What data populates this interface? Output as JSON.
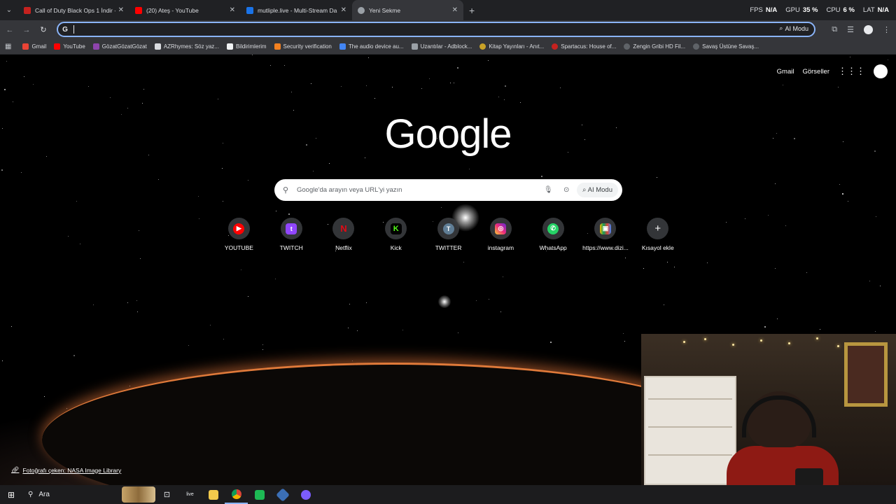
{
  "browser": {
    "tabs": [
      {
        "title": "Call of Duty Black Ops 1 İndir - ",
        "favicon_color": "#c5221f",
        "active": false
      },
      {
        "title": "(20) Ateş - YouTube",
        "favicon_color": "#ff0000",
        "active": false
      },
      {
        "title": "mutliple.live - Multi-Stream Da",
        "favicon_color": "#1a73e8",
        "active": false
      },
      {
        "title": "Yeni Sekme",
        "favicon_color": "#9aa0a6",
        "active": true
      }
    ],
    "new_tab_icon": "plus-icon",
    "overlay_stats": {
      "fps_label": "FPS",
      "fps_value": "N/A",
      "gpu_label": "GPU",
      "gpu_value": "35 %",
      "cpu_label": "CPU",
      "cpu_value": "6 %",
      "lat_label": "LAT",
      "lat_value": "N/A"
    },
    "omnibox": {
      "value": "",
      "ai_mode_label": "AI Modu"
    },
    "bookmarks": [
      {
        "label": "Gmail",
        "color": "#ea4335"
      },
      {
        "label": "YouTube",
        "color": "#ff0000"
      },
      {
        "label": "GözatGözatGözat",
        "color": "#8e44ad"
      },
      {
        "label": "AZRhymes: Söz yaz...",
        "color": "#dadce0"
      },
      {
        "label": "Bildirimlerim",
        "color": "#f1f3f4"
      },
      {
        "label": "Security verification",
        "color": "#f48120"
      },
      {
        "label": "The audio device au...",
        "color": "#4285f4"
      },
      {
        "label": "Uzantılar - Adblock...",
        "color": "#9aa0a6"
      },
      {
        "label": "Kitap Yayınları - Anıt...",
        "color": "#c9a227"
      },
      {
        "label": "Spartacus: House of...",
        "color": "#c5221f"
      },
      {
        "label": "Zengin Gribi HD Fil...",
        "color": "#5f6368"
      },
      {
        "label": "Savaş Üstüne Savaş...",
        "color": "#5f6368"
      }
    ]
  },
  "newtab": {
    "links": {
      "gmail": "Gmail",
      "images": "Görseller"
    },
    "logo": "Google",
    "search": {
      "placeholder": "Google'da arayın veya URL'yi yazın",
      "ai_mode_label": "AI Modu"
    },
    "shortcuts": [
      {
        "label": "YOUTUBE",
        "icon": "youtube-icon",
        "color": "#ff0000",
        "glyph": "▶"
      },
      {
        "label": "TWITCH",
        "icon": "twitch-icon",
        "color": "#9146ff",
        "glyph": "t"
      },
      {
        "label": "Netflix",
        "icon": "netflix-icon",
        "color": "#e50914",
        "glyph": "N"
      },
      {
        "label": "Kick",
        "icon": "kick-icon",
        "color": "#53fc18",
        "glyph": "K"
      },
      {
        "label": "TWITTER",
        "icon": "twitter-icon",
        "color": "#5f7d95",
        "glyph": "T"
      },
      {
        "label": "instagram",
        "icon": "instagram-icon",
        "color": "#e1306c",
        "glyph": "◎"
      },
      {
        "label": "WhatsApp",
        "icon": "whatsapp-icon",
        "color": "#25d366",
        "glyph": "✆"
      },
      {
        "label": "https://www.dizi...",
        "icon": "tv-icon",
        "color": "#3c4043",
        "glyph": "▣"
      },
      {
        "label": "Kısayol ekle",
        "icon": "plus-icon",
        "color": "#3c4043",
        "glyph": "+"
      }
    ],
    "photo_credit": "Fotoğrafı çeken: NASA Image Library"
  },
  "taskbar": {
    "search_label": "Ara",
    "apps": [
      {
        "name": "task-view-icon",
        "glyph": "⊞",
        "color": "#2b2b2b"
      },
      {
        "name": "live-icon",
        "glyph": "live",
        "color": "#2b2b2b"
      },
      {
        "name": "file-explorer-icon",
        "glyph": "▬",
        "color": "#f2c94c"
      },
      {
        "name": "chrome-icon",
        "glyph": "◉",
        "color": "#4285f4"
      },
      {
        "name": "app-icon",
        "glyph": "◙",
        "color": "#1db954"
      },
      {
        "name": "app-icon",
        "glyph": "✦",
        "color": "#3b6fb6"
      },
      {
        "name": "app-icon",
        "glyph": "◈",
        "color": "#7b5cff"
      }
    ]
  }
}
